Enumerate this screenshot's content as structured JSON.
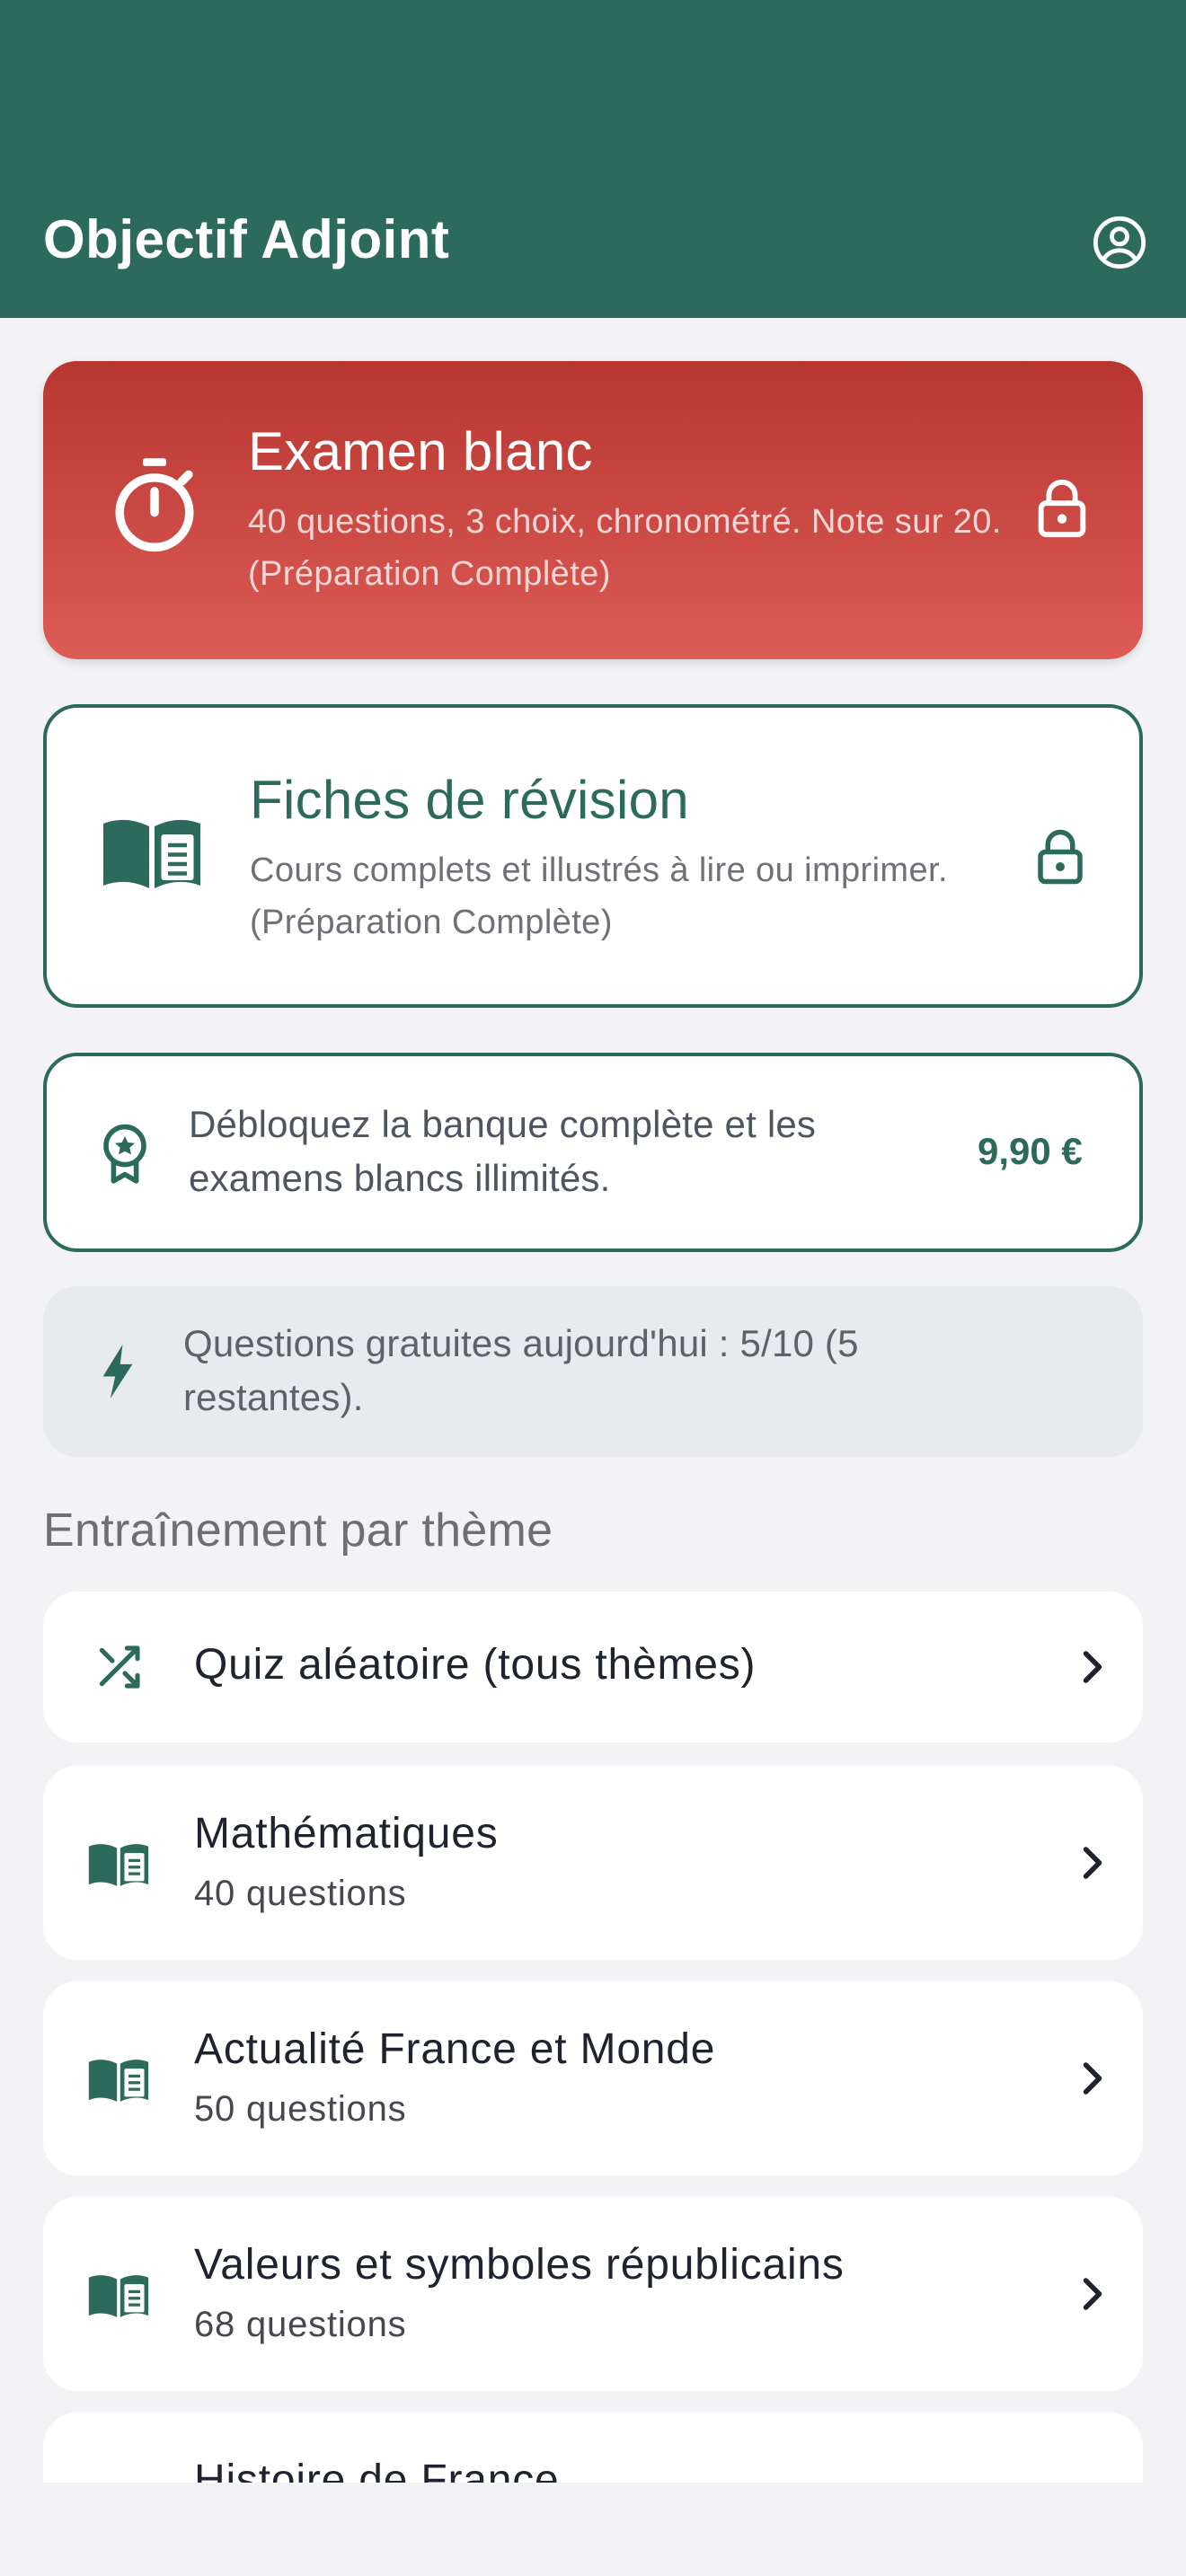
{
  "app": {
    "title": "Objectif Adjoint",
    "colors": {
      "primary": "#2c6a5c",
      "exam_red": "#c9443f",
      "background": "#f3f3f5"
    }
  },
  "header": {
    "account_icon": "account-circle-icon"
  },
  "exam_card": {
    "title": "Examen blanc",
    "description": "40 questions, 3 choix, chronométré. Note sur 20. (Préparation Complète)",
    "icon": "stopwatch-icon",
    "lock_icon": "lock-icon"
  },
  "fiches_card": {
    "title": "Fiches de révision",
    "description": "Cours complets et illustrés à lire ou imprimer. (Préparation Complète)",
    "icon": "open-book-icon",
    "lock_icon": "lock-icon"
  },
  "premium_card": {
    "text": "Débloquez la banque complète et les examens blancs illimités.",
    "price": "9,90 €",
    "icon": "award-badge-icon"
  },
  "free_card": {
    "text": "Questions gratuites aujourd'hui : 5/10 (5 restantes).",
    "icon": "lightning-icon"
  },
  "section": {
    "title": "Entraînement par thème"
  },
  "themes": [
    {
      "name": "Quiz aléatoire (tous thèmes)",
      "count": "",
      "icon": "shuffle-icon"
    },
    {
      "name": "Mathématiques",
      "count": "40 questions",
      "icon": "book-icon"
    },
    {
      "name": "Actualité France et Monde",
      "count": "50 questions",
      "icon": "book-icon"
    },
    {
      "name": "Valeurs et symboles républicains",
      "count": "68 questions",
      "icon": "book-icon"
    },
    {
      "name": "Histoire de France",
      "count": "",
      "icon": "book-icon"
    }
  ]
}
